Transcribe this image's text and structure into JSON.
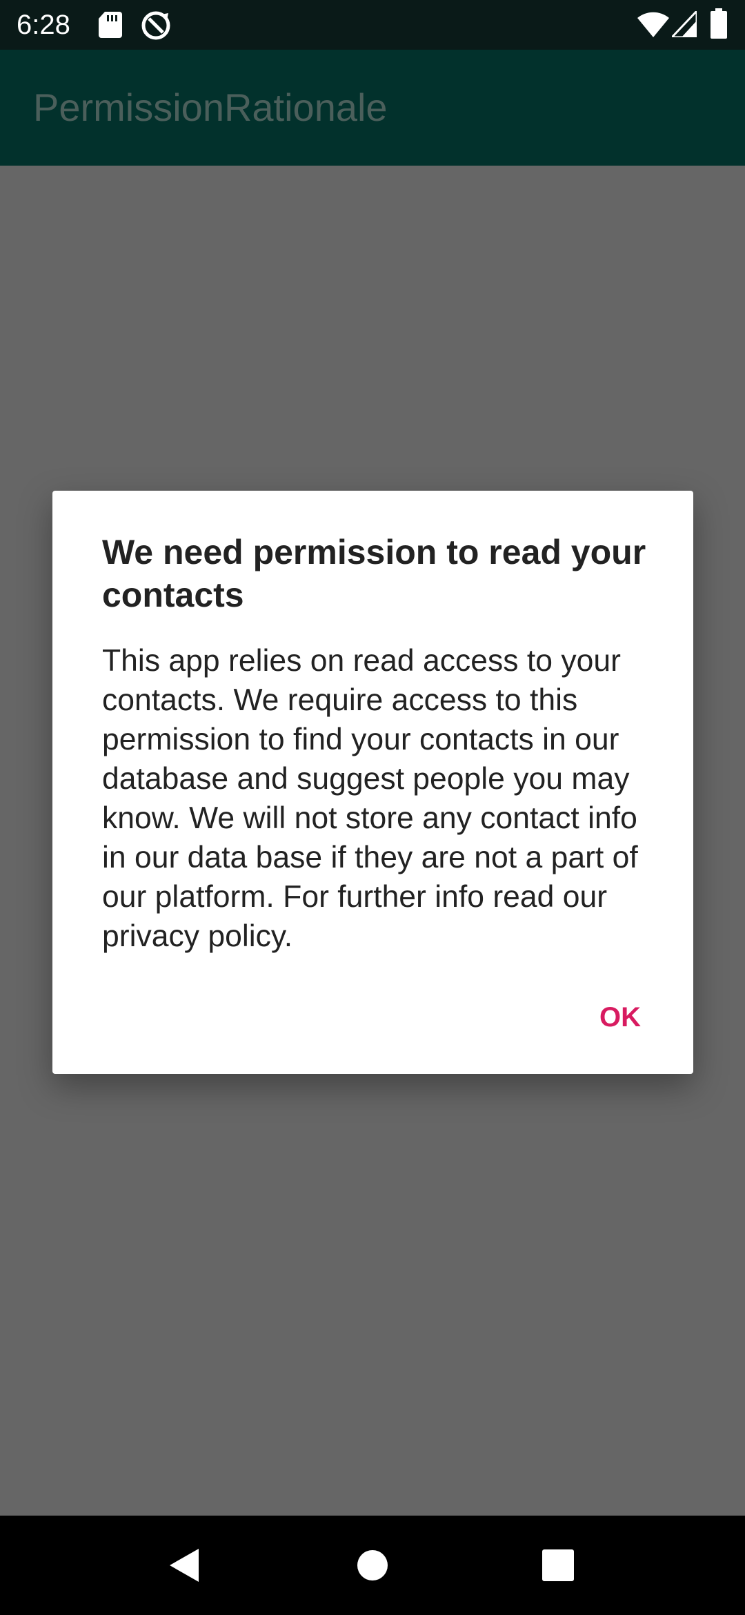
{
  "status_bar": {
    "time": "6:28",
    "left_icons": [
      "sd-card-icon",
      "data-saver-icon"
    ],
    "right_icons": [
      "wifi-icon",
      "signal-icon",
      "battery-icon"
    ]
  },
  "app_bar": {
    "title": "PermissionRationale"
  },
  "dialog": {
    "title": "We need permission to read your contacts",
    "message": "This app relies on read access to your contacts. We require access to this permission to find your contacts in our database and suggest people you may know. We will not store any contact info in our data base if they are not a part of our platform. For further info read our privacy policy.",
    "ok_label": "OK"
  },
  "navigation": {
    "buttons": [
      "back-icon",
      "home-icon",
      "recents-icon"
    ]
  },
  "colors": {
    "status_bar": "#0a1a18",
    "app_bar": "#02312c",
    "scrim": "#666666",
    "dialog_bg": "#ffffff",
    "accent": "#d81b60",
    "nav_bar": "#000000"
  }
}
